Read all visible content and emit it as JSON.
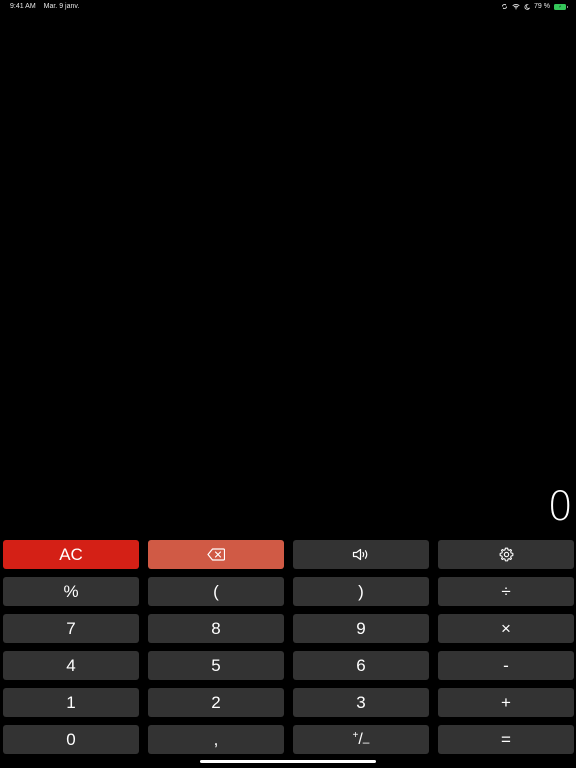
{
  "status": {
    "time": "9:41 AM",
    "date": "Mar. 9 janv.",
    "battery_pct": "79 %"
  },
  "display": {
    "value": "0"
  },
  "keys": {
    "clear": "AC",
    "percent": "%",
    "open_paren": "(",
    "close_paren": ")",
    "divide": "÷",
    "seven": "7",
    "eight": "8",
    "nine": "9",
    "multiply": "×",
    "four": "4",
    "five": "5",
    "six": "6",
    "minus": "-",
    "one": "1",
    "two": "2",
    "three": "3",
    "plus": "+",
    "zero": "0",
    "decimal": ",",
    "plusminus_top": "+",
    "plusminus_slash": "/",
    "plusminus_bottom": "–",
    "equals": "="
  },
  "icons": {
    "backspace": "backspace-icon",
    "sound": "speaker-icon",
    "settings": "gear-icon"
  },
  "colors": {
    "clear_button": "#d42016",
    "backspace_button": "#d05a45",
    "key_background": "#333333",
    "background": "#000000"
  }
}
